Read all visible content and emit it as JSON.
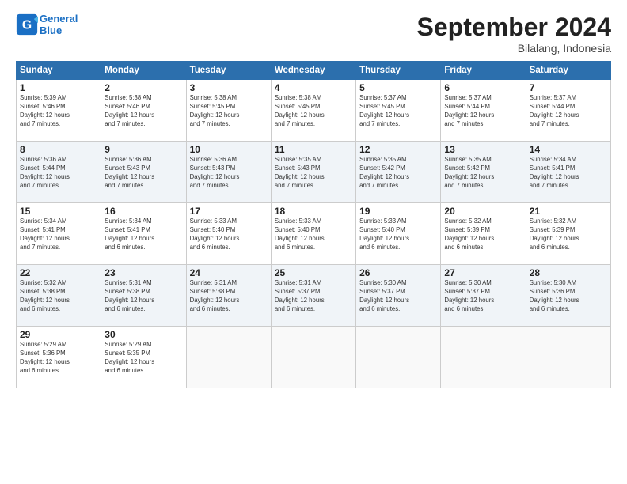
{
  "header": {
    "logo_line1": "General",
    "logo_line2": "Blue",
    "month": "September 2024",
    "location": "Bilalang, Indonesia"
  },
  "weekdays": [
    "Sunday",
    "Monday",
    "Tuesday",
    "Wednesday",
    "Thursday",
    "Friday",
    "Saturday"
  ],
  "weeks": [
    [
      {
        "day": "1",
        "sunrise": "Sunrise: 5:39 AM",
        "sunset": "Sunset: 5:46 PM",
        "daylight": "Daylight: 12 hours and 7 minutes."
      },
      {
        "day": "2",
        "sunrise": "Sunrise: 5:38 AM",
        "sunset": "Sunset: 5:46 PM",
        "daylight": "Daylight: 12 hours and 7 minutes."
      },
      {
        "day": "3",
        "sunrise": "Sunrise: 5:38 AM",
        "sunset": "Sunset: 5:45 PM",
        "daylight": "Daylight: 12 hours and 7 minutes."
      },
      {
        "day": "4",
        "sunrise": "Sunrise: 5:38 AM",
        "sunset": "Sunset: 5:45 PM",
        "daylight": "Daylight: 12 hours and 7 minutes."
      },
      {
        "day": "5",
        "sunrise": "Sunrise: 5:37 AM",
        "sunset": "Sunset: 5:45 PM",
        "daylight": "Daylight: 12 hours and 7 minutes."
      },
      {
        "day": "6",
        "sunrise": "Sunrise: 5:37 AM",
        "sunset": "Sunset: 5:44 PM",
        "daylight": "Daylight: 12 hours and 7 minutes."
      },
      {
        "day": "7",
        "sunrise": "Sunrise: 5:37 AM",
        "sunset": "Sunset: 5:44 PM",
        "daylight": "Daylight: 12 hours and 7 minutes."
      }
    ],
    [
      {
        "day": "8",
        "sunrise": "Sunrise: 5:36 AM",
        "sunset": "Sunset: 5:44 PM",
        "daylight": "Daylight: 12 hours and 7 minutes."
      },
      {
        "day": "9",
        "sunrise": "Sunrise: 5:36 AM",
        "sunset": "Sunset: 5:43 PM",
        "daylight": "Daylight: 12 hours and 7 minutes."
      },
      {
        "day": "10",
        "sunrise": "Sunrise: 5:36 AM",
        "sunset": "Sunset: 5:43 PM",
        "daylight": "Daylight: 12 hours and 7 minutes."
      },
      {
        "day": "11",
        "sunrise": "Sunrise: 5:35 AM",
        "sunset": "Sunset: 5:43 PM",
        "daylight": "Daylight: 12 hours and 7 minutes."
      },
      {
        "day": "12",
        "sunrise": "Sunrise: 5:35 AM",
        "sunset": "Sunset: 5:42 PM",
        "daylight": "Daylight: 12 hours and 7 minutes."
      },
      {
        "day": "13",
        "sunrise": "Sunrise: 5:35 AM",
        "sunset": "Sunset: 5:42 PM",
        "daylight": "Daylight: 12 hours and 7 minutes."
      },
      {
        "day": "14",
        "sunrise": "Sunrise: 5:34 AM",
        "sunset": "Sunset: 5:41 PM",
        "daylight": "Daylight: 12 hours and 7 minutes."
      }
    ],
    [
      {
        "day": "15",
        "sunrise": "Sunrise: 5:34 AM",
        "sunset": "Sunset: 5:41 PM",
        "daylight": "Daylight: 12 hours and 7 minutes."
      },
      {
        "day": "16",
        "sunrise": "Sunrise: 5:34 AM",
        "sunset": "Sunset: 5:41 PM",
        "daylight": "Daylight: 12 hours and 6 minutes."
      },
      {
        "day": "17",
        "sunrise": "Sunrise: 5:33 AM",
        "sunset": "Sunset: 5:40 PM",
        "daylight": "Daylight: 12 hours and 6 minutes."
      },
      {
        "day": "18",
        "sunrise": "Sunrise: 5:33 AM",
        "sunset": "Sunset: 5:40 PM",
        "daylight": "Daylight: 12 hours and 6 minutes."
      },
      {
        "day": "19",
        "sunrise": "Sunrise: 5:33 AM",
        "sunset": "Sunset: 5:40 PM",
        "daylight": "Daylight: 12 hours and 6 minutes."
      },
      {
        "day": "20",
        "sunrise": "Sunrise: 5:32 AM",
        "sunset": "Sunset: 5:39 PM",
        "daylight": "Daylight: 12 hours and 6 minutes."
      },
      {
        "day": "21",
        "sunrise": "Sunrise: 5:32 AM",
        "sunset": "Sunset: 5:39 PM",
        "daylight": "Daylight: 12 hours and 6 minutes."
      }
    ],
    [
      {
        "day": "22",
        "sunrise": "Sunrise: 5:32 AM",
        "sunset": "Sunset: 5:38 PM",
        "daylight": "Daylight: 12 hours and 6 minutes."
      },
      {
        "day": "23",
        "sunrise": "Sunrise: 5:31 AM",
        "sunset": "Sunset: 5:38 PM",
        "daylight": "Daylight: 12 hours and 6 minutes."
      },
      {
        "day": "24",
        "sunrise": "Sunrise: 5:31 AM",
        "sunset": "Sunset: 5:38 PM",
        "daylight": "Daylight: 12 hours and 6 minutes."
      },
      {
        "day": "25",
        "sunrise": "Sunrise: 5:31 AM",
        "sunset": "Sunset: 5:37 PM",
        "daylight": "Daylight: 12 hours and 6 minutes."
      },
      {
        "day": "26",
        "sunrise": "Sunrise: 5:30 AM",
        "sunset": "Sunset: 5:37 PM",
        "daylight": "Daylight: 12 hours and 6 minutes."
      },
      {
        "day": "27",
        "sunrise": "Sunrise: 5:30 AM",
        "sunset": "Sunset: 5:37 PM",
        "daylight": "Daylight: 12 hours and 6 minutes."
      },
      {
        "day": "28",
        "sunrise": "Sunrise: 5:30 AM",
        "sunset": "Sunset: 5:36 PM",
        "daylight": "Daylight: 12 hours and 6 minutes."
      }
    ],
    [
      {
        "day": "29",
        "sunrise": "Sunrise: 5:29 AM",
        "sunset": "Sunset: 5:36 PM",
        "daylight": "Daylight: 12 hours and 6 minutes."
      },
      {
        "day": "30",
        "sunrise": "Sunrise: 5:29 AM",
        "sunset": "Sunset: 5:35 PM",
        "daylight": "Daylight: 12 hours and 6 minutes."
      },
      null,
      null,
      null,
      null,
      null
    ]
  ]
}
